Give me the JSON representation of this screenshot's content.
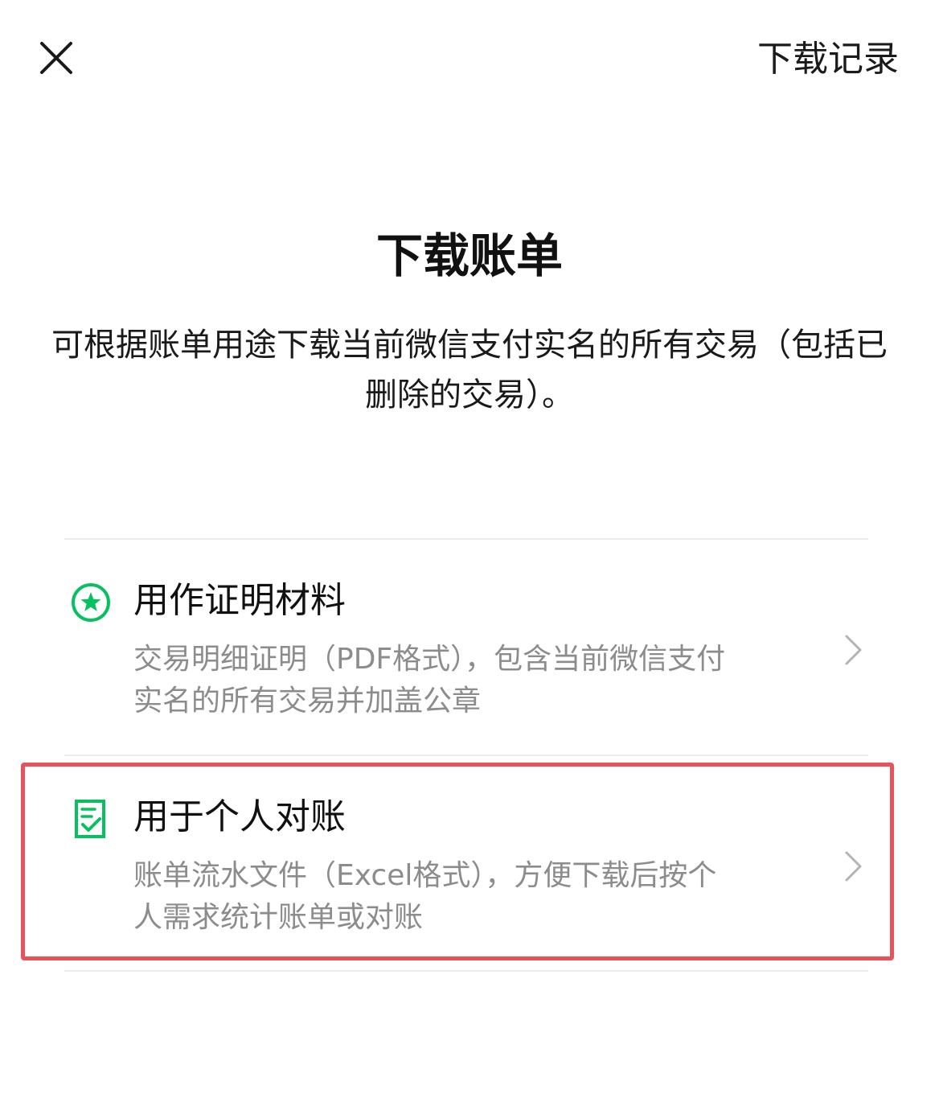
{
  "header": {
    "close_icon": "close-icon",
    "records_label": "下载记录"
  },
  "main": {
    "title": "下载账单",
    "description": "可根据账单用途下载当前微信支付实名的所有交易（包括已删除的交易）。"
  },
  "options": [
    {
      "icon": "star-circle-icon",
      "title": "用作证明材料",
      "description": "交易明细证明（PDF格式），包含当前微信支付实名的所有交易并加盖公章",
      "chevron_icon": "chevron-right-icon"
    },
    {
      "icon": "document-check-icon",
      "title": "用于个人对账",
      "description": "账单流水文件（Excel格式），方便下载后按个人需求统计账单或对账",
      "chevron_icon": "chevron-right-icon"
    }
  ],
  "colors": {
    "accent_green": "#07c160",
    "highlight_red": "#e8525b",
    "secondary_text": "#8c8c8c"
  }
}
